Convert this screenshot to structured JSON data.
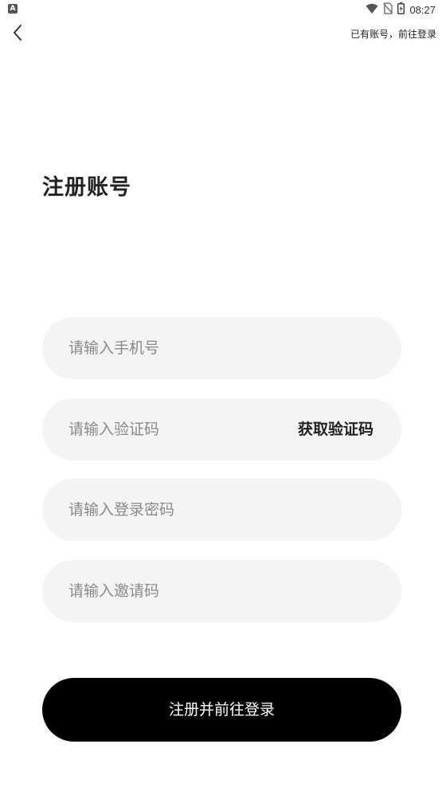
{
  "status_bar": {
    "time": "08:27",
    "app_icon_letter": "A",
    "icons": [
      "wifi-icon",
      "no-sim-icon",
      "battery-icon"
    ]
  },
  "nav": {
    "back_icon": "chevron-left-icon",
    "login_link": "已有账号，前往登录"
  },
  "page": {
    "title": "注册账号"
  },
  "form": {
    "phone_placeholder": "请输入手机号",
    "code_placeholder": "请输入验证码",
    "get_code_label": "获取验证码",
    "password_placeholder": "请输入登录密码",
    "invite_placeholder": "请输入邀请码",
    "submit_label": "注册并前往登录"
  },
  "colors": {
    "field_background": "#f4f4f4",
    "button_background": "#000000",
    "button_text": "#ffffff",
    "placeholder_text": "#8a8a8a"
  }
}
